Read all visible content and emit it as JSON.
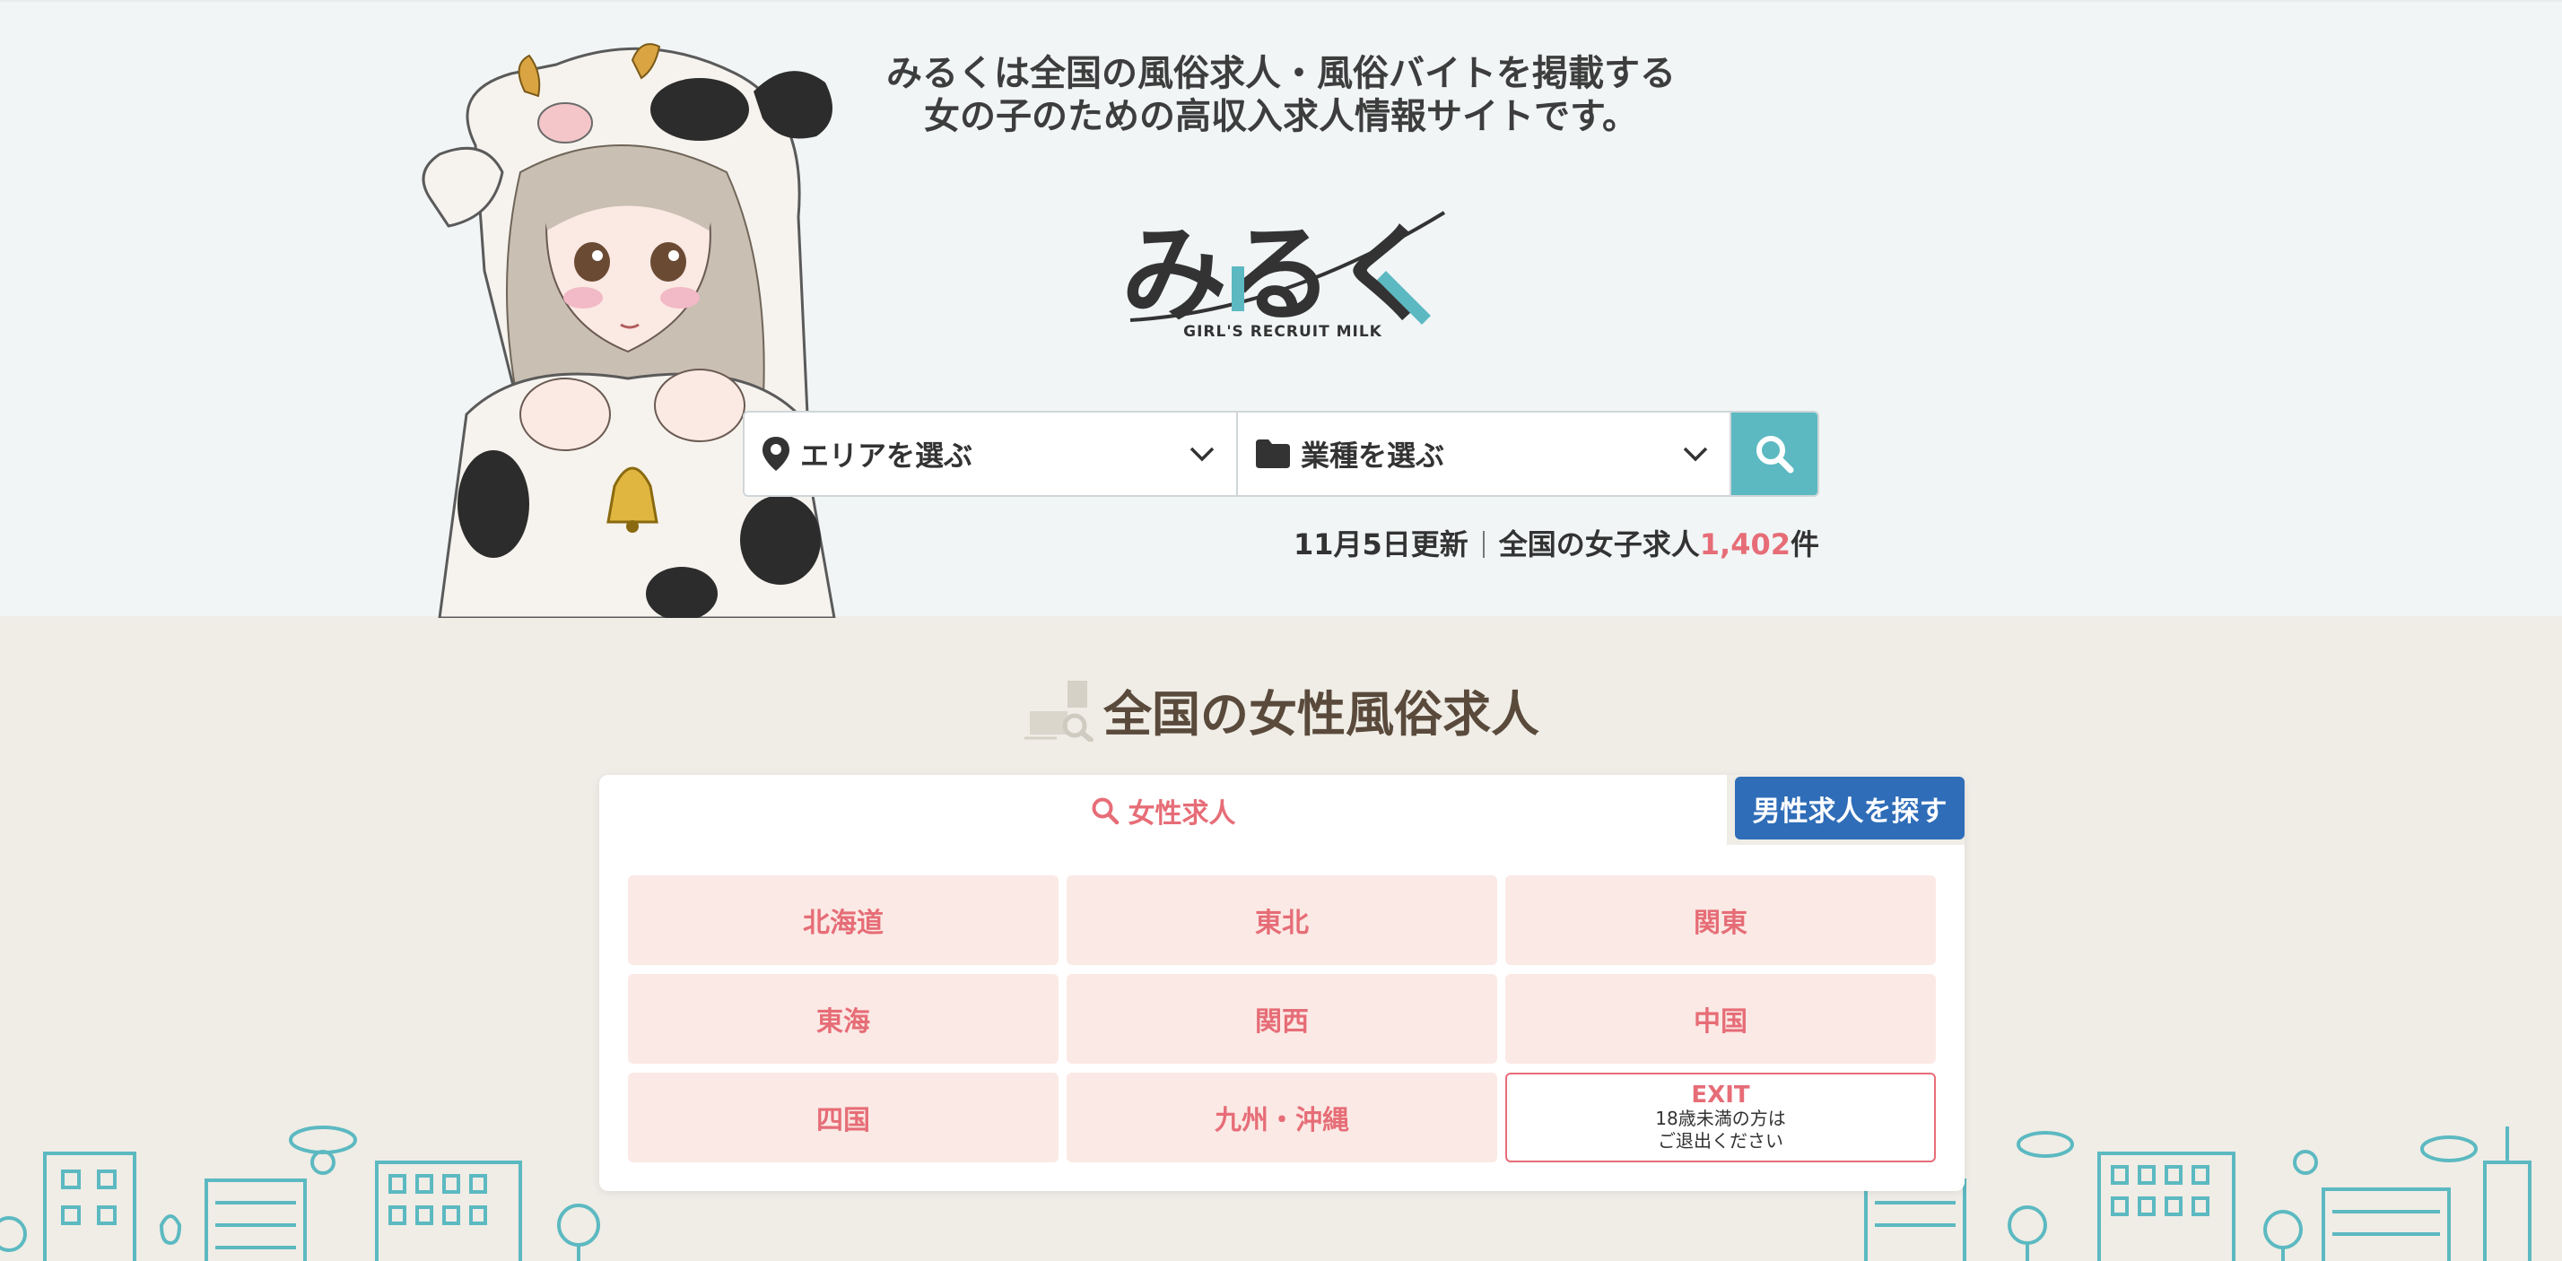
{
  "hero": {
    "tagline_line1": "みるくは全国の風俗求人・風俗バイトを掲載する",
    "tagline_line2": "女の子のための高収入求人情報サイトです。",
    "logo_text": "みるく",
    "logo_sub": "GIRL'S RECRUIT MILK"
  },
  "search": {
    "area_label": "エリアを選ぶ",
    "genre_label": "業種を選ぶ",
    "icons": [
      "map-pin-icon",
      "folder-icon",
      "chevron-down-icon",
      "search-icon"
    ],
    "accent": "#5cb9c1"
  },
  "status": {
    "updated": "11月5日更新",
    "label": "全国の女子求人",
    "count": "1,402",
    "unit": "件",
    "count_color": "#e66d77"
  },
  "section": {
    "title": "全国の女性風俗求人"
  },
  "tabs": {
    "female": "女性求人",
    "male": "男性求人を探す",
    "male_color": "#2f6db8"
  },
  "regions": [
    {
      "label": "北海道"
    },
    {
      "label": "東北"
    },
    {
      "label": "関東"
    },
    {
      "label": "東海"
    },
    {
      "label": "関西"
    },
    {
      "label": "中国"
    },
    {
      "label": "四国"
    },
    {
      "label": "九州・沖縄"
    }
  ],
  "exit": {
    "title": "EXIT",
    "line1": "18歳未満の方は",
    "line2": "ご退出ください"
  }
}
